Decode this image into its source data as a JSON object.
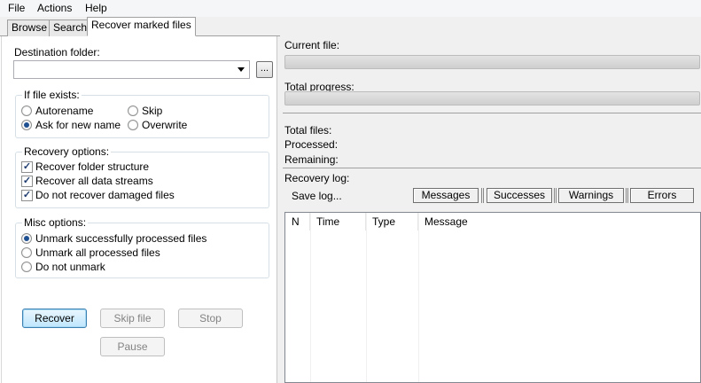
{
  "menu": {
    "items": [
      "File",
      "Actions",
      "Help"
    ]
  },
  "tabs": [
    "Browse",
    "Search",
    "Recover marked files"
  ],
  "destination": {
    "label": "Destination folder:",
    "value": "",
    "browse_label": "..."
  },
  "if_exists": {
    "title": "If file exists:",
    "options": [
      "Autorename",
      "Skip",
      "Ask for new name",
      "Overwrite"
    ],
    "selected": "Ask for new name"
  },
  "recovery_options": {
    "title": "Recovery options:",
    "items": [
      {
        "label": "Recover folder structure",
        "checked": true
      },
      {
        "label": "Recover all data streams",
        "checked": true
      },
      {
        "label": "Do not recover damaged files",
        "checked": true
      }
    ]
  },
  "misc_options": {
    "title": "Misc options:",
    "options": [
      "Unmark successfully processed files",
      "Unmark all processed files",
      "Do not unmark"
    ],
    "selected": "Unmark successfully processed files"
  },
  "buttons": {
    "recover": "Recover",
    "skip_file": "Skip file",
    "stop": "Stop",
    "pause": "Pause"
  },
  "status": {
    "current_file_label": "Current file:",
    "current_progress": 0,
    "total_progress_label": "Total progress:",
    "total_progress": 0,
    "total_files_label": "Total files:",
    "processed_label": "Processed:",
    "remaining_label": "Remaining:"
  },
  "log": {
    "title": "Recovery log:",
    "save_label": "Save log...",
    "filters": [
      "Messages",
      "Successes",
      "Warnings",
      "Errors"
    ],
    "columns": [
      "N",
      "Time",
      "Type",
      "Message"
    ]
  },
  "icons": {
    "combo_arrow": "chevron-down-icon",
    "check_mark": "✓"
  }
}
